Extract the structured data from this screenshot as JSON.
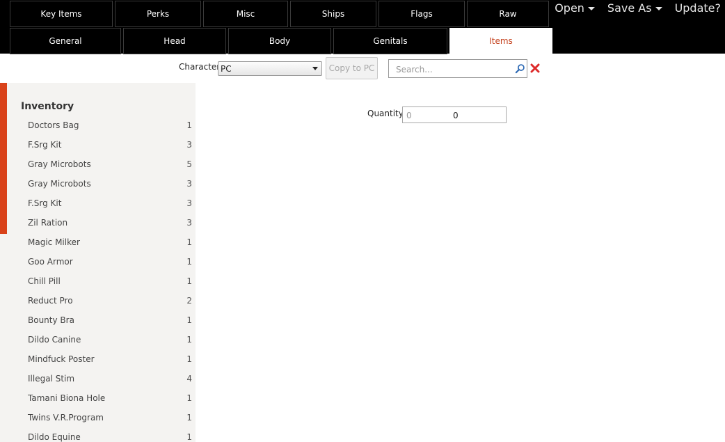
{
  "tabs_row1": [
    "Key Items",
    "Perks",
    "Misc",
    "Ships",
    "Flags",
    "Raw"
  ],
  "tabs_row2": [
    "General",
    "Head",
    "Body",
    "Genitals",
    "Items"
  ],
  "active_tab": "Items",
  "menu": {
    "open_label": "Open",
    "save_as_label": "Save As",
    "update_label": "Update?"
  },
  "toolbar": {
    "character_label": "Character",
    "character_value": "PC",
    "copy_label": "Copy to PC",
    "search_placeholder": "Search..."
  },
  "inventory": {
    "title": "Inventory",
    "items": [
      {
        "name": "Doctors Bag",
        "count": "1"
      },
      {
        "name": "F.Srg Kit",
        "count": "3"
      },
      {
        "name": "Gray Microbots",
        "count": "5"
      },
      {
        "name": "Gray Microbots",
        "count": "3"
      },
      {
        "name": "F.Srg Kit",
        "count": "3"
      },
      {
        "name": "Zil Ration",
        "count": "3"
      },
      {
        "name": "Magic Milker",
        "count": "1"
      },
      {
        "name": "Goo Armor",
        "count": "1"
      },
      {
        "name": "Chill Pill",
        "count": "1"
      },
      {
        "name": "Reduct Pro",
        "count": "2"
      },
      {
        "name": "Bounty Bra",
        "count": "1"
      },
      {
        "name": "Dildo Canine",
        "count": "1"
      },
      {
        "name": "Mindfuck Poster",
        "count": "1"
      },
      {
        "name": "Illegal Stim",
        "count": "4"
      },
      {
        "name": "Tamani Biona Hole",
        "count": "1"
      },
      {
        "name": "Twins V.R.Program",
        "count": "1"
      },
      {
        "name": "Dildo Equine",
        "count": "1"
      }
    ]
  },
  "quantity": {
    "label": "Quantity",
    "min": "0",
    "value": "0"
  },
  "colors": {
    "accent": "#d9421a",
    "active_tab_text": "#c4401c",
    "topbar": "#000000",
    "sidebar_bg": "#f4f3f1"
  }
}
